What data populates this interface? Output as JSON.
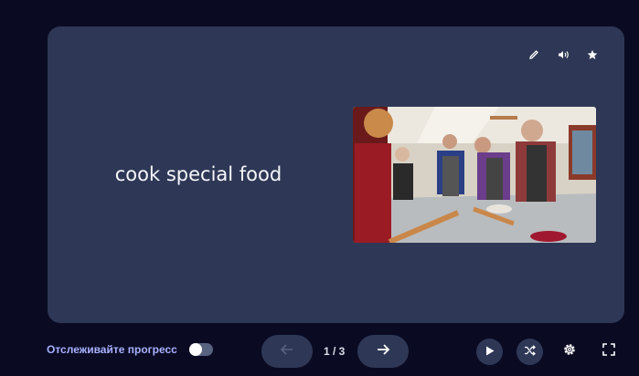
{
  "card": {
    "term": "cook special food",
    "actions": [
      {
        "icon": "pencil-icon"
      },
      {
        "icon": "speaker-icon"
      },
      {
        "icon": "star-icon"
      }
    ],
    "image": {
      "description": "",
      "icon": "photo"
    }
  },
  "footer": {
    "progress_label": "Отслеживайте прогресс",
    "progress_toggle_on": false,
    "counter": "1 / 3",
    "prev_icon": "arrow-left-icon",
    "next_icon": "arrow-right-icon",
    "play_icon": "play-icon",
    "shuffle_icon": "shuffle-icon",
    "settings_icon": "gear-icon",
    "fullscreen_icon": "fullscreen-icon"
  },
  "colors": {
    "background": "#0a0a23",
    "card": "#2e3856",
    "accent": "#a8b1ff"
  }
}
